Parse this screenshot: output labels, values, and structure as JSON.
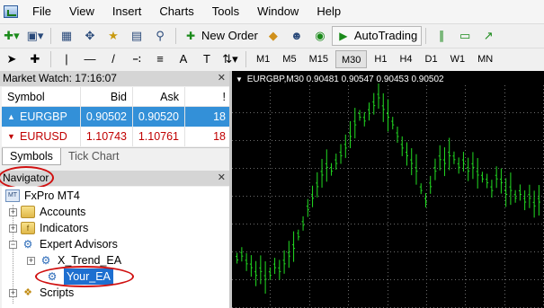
{
  "menu": {
    "items": [
      "File",
      "View",
      "Insert",
      "Charts",
      "Tools",
      "Window",
      "Help"
    ]
  },
  "toolbar": {
    "new_order_label": "New Order",
    "autotrading_label": "AutoTrading",
    "timeframes": [
      "M1",
      "M5",
      "M15",
      "M30",
      "H1",
      "H4",
      "D1",
      "W1",
      "MN"
    ],
    "active_timeframe": "M30"
  },
  "market_watch": {
    "title": "Market Watch: 17:16:07",
    "columns": {
      "symbol": "Symbol",
      "bid": "Bid",
      "ask": "Ask",
      "spread": "!"
    },
    "rows": [
      {
        "symbol": "EURGBP",
        "bid": "0.90502",
        "ask": "0.90520",
        "spread": "18",
        "direction": "up",
        "selected": true
      },
      {
        "symbol": "EURUSD",
        "bid": "1.10743",
        "ask": "1.10761",
        "spread": "18",
        "direction": "down",
        "selected": false
      }
    ],
    "tabs": [
      "Symbols",
      "Tick Chart"
    ]
  },
  "navigator": {
    "title": "Navigator",
    "tree": {
      "root": "FxPro MT4",
      "accounts": "Accounts",
      "indicators": "Indicators",
      "expert_advisors": "Expert Advisors",
      "ea_1": "X_Trend_EA",
      "ea_2": "Your_EA",
      "scripts": "Scripts"
    }
  },
  "chart": {
    "info_symbol": "EURGBP,M30",
    "info_values": "0.90481 0.90547 0.90453 0.90502",
    "bar_color": "#22dd22",
    "grid_color": "#6b6b6b"
  },
  "colors": {
    "highlight_oval": "#d01010",
    "selected_row": "#3390d8"
  },
  "chart_data": {
    "type": "bar",
    "title": "",
    "xlabel": "",
    "ylabel": "",
    "series": [
      {
        "values": [
          0.902,
          0.9021,
          0.9019,
          0.9018,
          0.9016,
          0.9017,
          0.9015,
          0.9016,
          0.9018,
          0.9017,
          0.9019,
          0.9021,
          0.9023,
          0.9026,
          0.9029,
          0.9033,
          0.9036,
          0.9039,
          0.9042,
          0.9044,
          0.9043,
          0.9045,
          0.9047,
          0.9049,
          0.9052,
          0.9055,
          0.9057,
          0.9056,
          0.9058,
          0.906,
          0.9062,
          0.9059,
          0.9057,
          0.9055,
          0.9052,
          0.9049,
          0.9047,
          0.9045,
          0.9043,
          0.9038,
          0.9035,
          0.9039,
          0.9043,
          0.9046,
          0.9045,
          0.9047,
          0.9046,
          0.9044,
          0.9045,
          0.9043,
          0.9044,
          0.9042,
          0.9041,
          0.904,
          0.9038,
          0.9041,
          0.904,
          0.9037,
          0.9038,
          0.9036,
          0.9037,
          0.9035,
          0.9036,
          0.9034,
          0.9035
        ]
      }
    ]
  }
}
